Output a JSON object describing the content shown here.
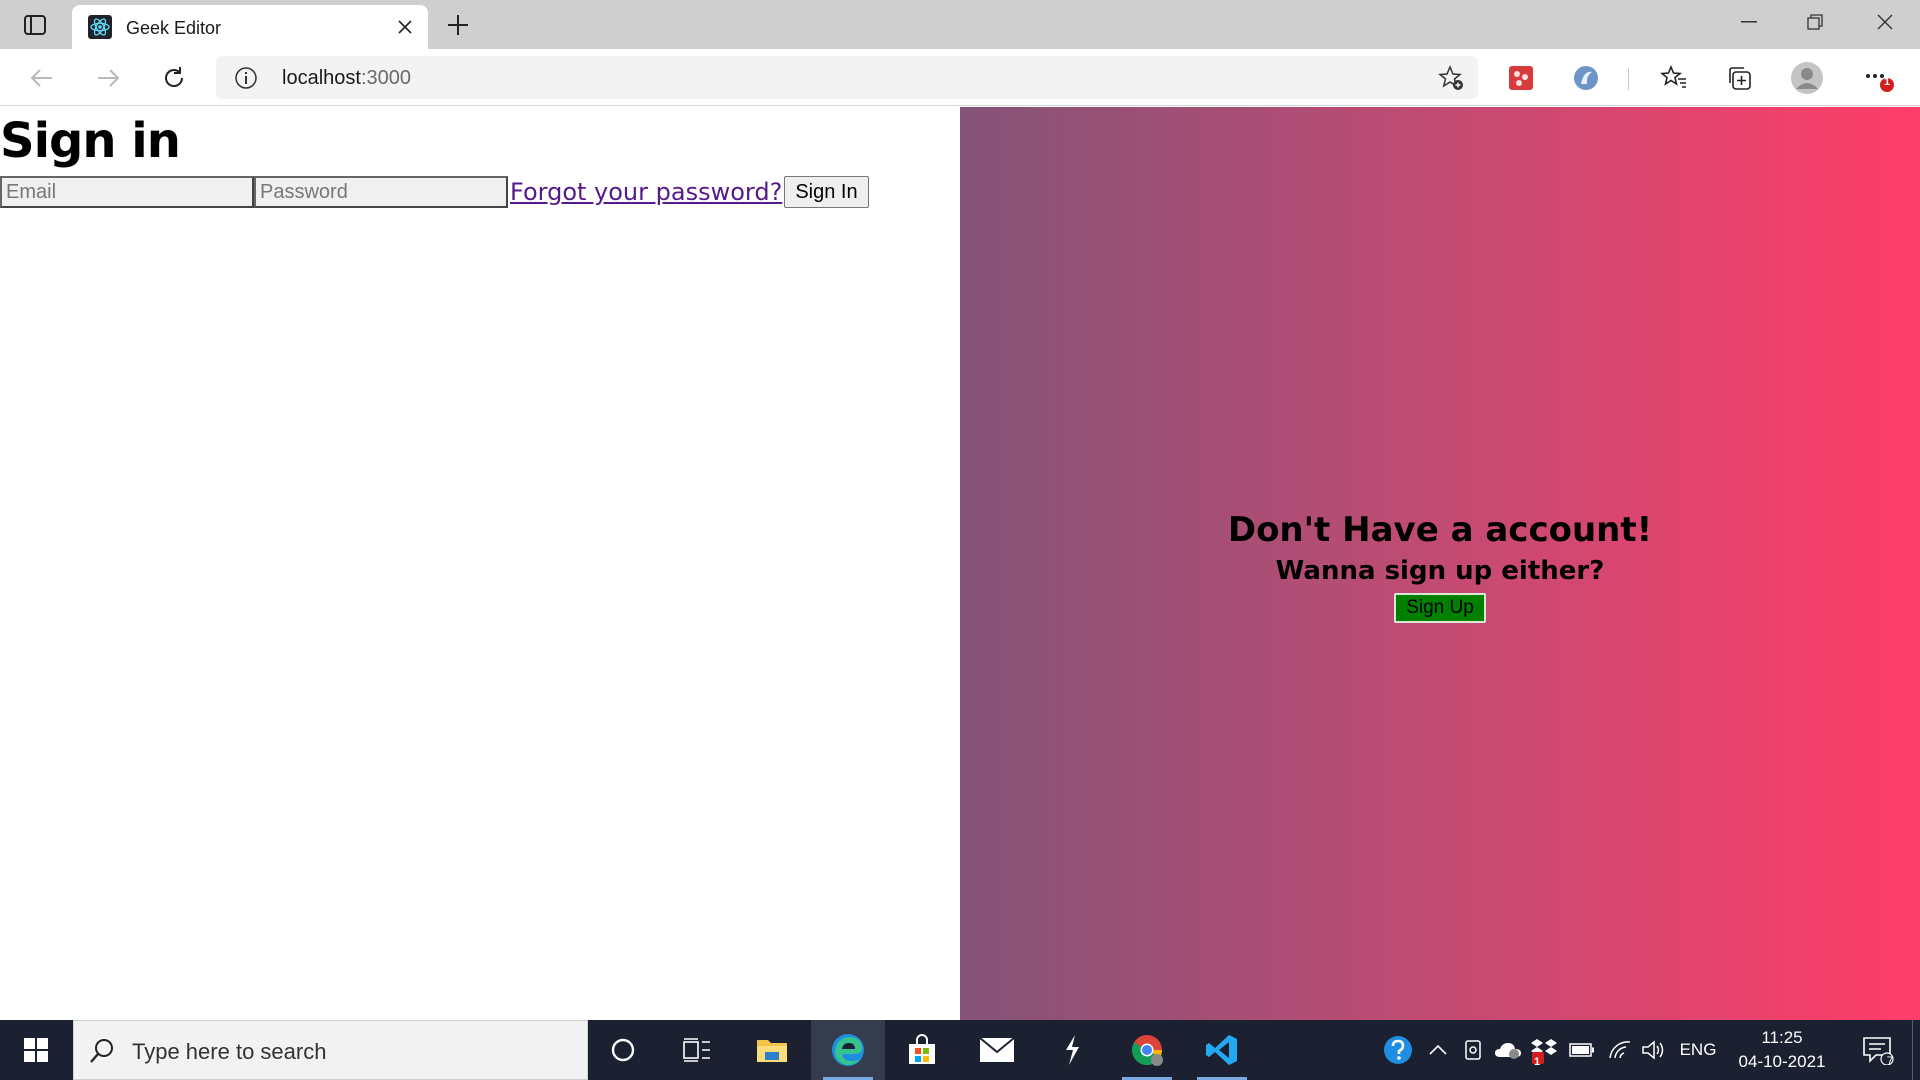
{
  "browser": {
    "tab": {
      "title": "Geek Editor",
      "favicon": "react-icon",
      "close_icon": "close-icon"
    },
    "new_tab_icon": "plus-icon",
    "window_controls": [
      "minimize-icon",
      "restore-icon",
      "close-icon"
    ],
    "address": {
      "host": "localhost",
      "port": ":3000",
      "info_icon": "info-icon",
      "favorite_add_icon": "favorite-add-icon"
    },
    "nav_icons": [
      "back-icon",
      "forward-icon",
      "refresh-icon"
    ],
    "toolbar_icons": [
      "extension-red-icon",
      "extension-blue-icon",
      "favorites-icon",
      "collections-icon",
      "profile-avatar",
      "more-icon"
    ],
    "more_badge": "1"
  },
  "page": {
    "signin": {
      "title": "Sign in",
      "email_placeholder": "Email",
      "password_placeholder": "Password",
      "forgot_link": "Forgot your password?",
      "button": "Sign In"
    },
    "signup": {
      "title": "Don't Have a account!",
      "subtitle": "Wanna sign up either?",
      "button": "Sign Up"
    },
    "colors": {
      "gradient_start": "#845376",
      "gradient_end": "#ff3d69",
      "signup_button": "#008000",
      "link": "#551a8b"
    }
  },
  "taskbar": {
    "search_placeholder": "Type here to search",
    "pinned": [
      "cortana-icon",
      "task-view-icon",
      "file-explorer-icon",
      "edge-icon",
      "store-icon",
      "mail-icon",
      "app-s-icon",
      "chrome-icon",
      "vscode-icon"
    ],
    "tray": {
      "language": "ENG",
      "badge_count": "1",
      "notification_count": "7"
    },
    "clock": {
      "time": "11:25",
      "date": "04-10-2021"
    }
  }
}
